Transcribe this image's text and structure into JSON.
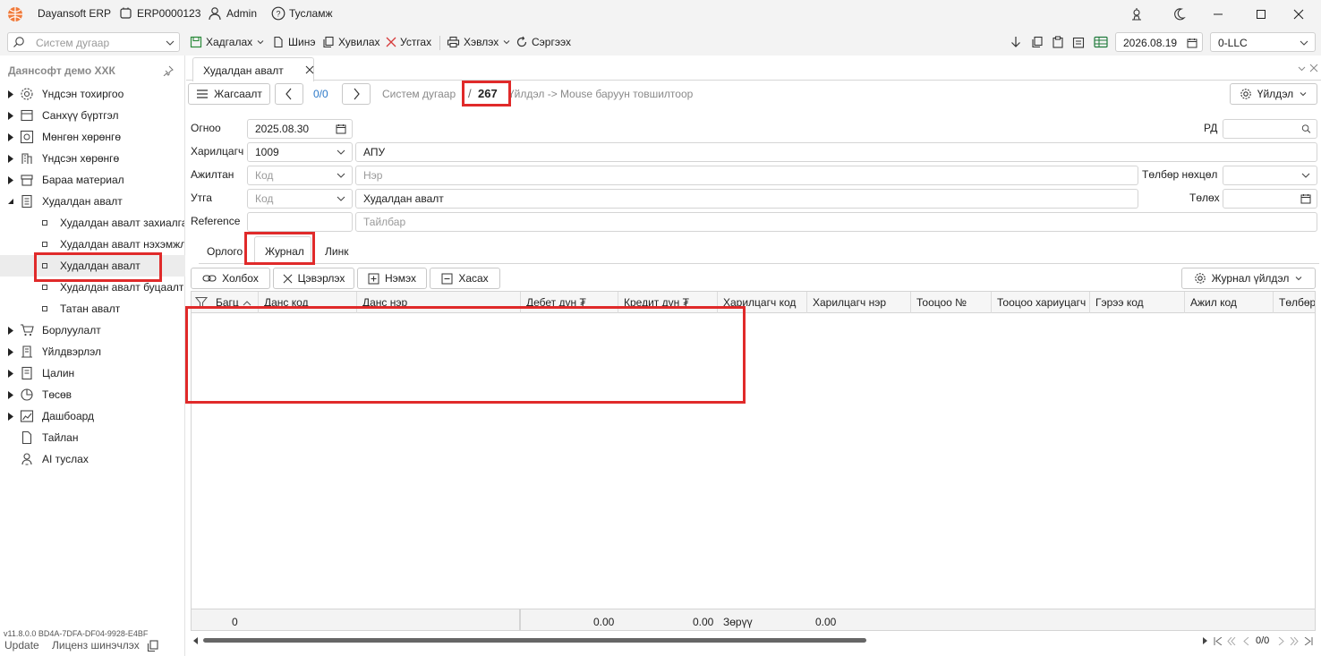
{
  "titlebar": {
    "app_name": "Dayansoft ERP",
    "erp_code": "ERP0000123",
    "user": "Admin",
    "help": "Тусламж"
  },
  "toolbar": {
    "search_placeholder": "Систем дугаар",
    "save": "Хадгалах",
    "new": "Шинэ",
    "copy": "Хувилах",
    "delete": "Устгах",
    "print": "Хэвлэх",
    "refresh": "Сэргээх",
    "date": "2026.08.19",
    "company": "0-LLC"
  },
  "sidebar": {
    "company": "Даянсофт демо ХХК",
    "items": [
      {
        "label": "Үндсэн тохиргоо",
        "icon": "gear-icon",
        "expand": "▸"
      },
      {
        "label": "Санхүү бүртгэл",
        "icon": "ledger-icon",
        "expand": "▸"
      },
      {
        "label": "Мөнгөн хөрөнгө",
        "icon": "money-icon",
        "expand": "▸"
      },
      {
        "label": "Үндсэн хөрөнгө",
        "icon": "building-icon",
        "expand": "▸"
      },
      {
        "label": "Бараа материал",
        "icon": "inventory-icon",
        "expand": "▸"
      },
      {
        "label": "Худалдан авалт",
        "icon": "purchase-icon",
        "expand": "▾"
      },
      {
        "label": "Худалдан авалт захиалга",
        "icon": "leaf-icon",
        "expand": ""
      },
      {
        "label": "Худалдан авалт нэхэмжлэх",
        "icon": "leaf-icon",
        "expand": ""
      },
      {
        "label": "Худалдан авалт",
        "icon": "leaf-icon",
        "expand": ""
      },
      {
        "label": "Худалдан авалт буцаалт",
        "icon": "leaf-icon",
        "expand": ""
      },
      {
        "label": "Татан авалт",
        "icon": "leaf-icon",
        "expand": ""
      },
      {
        "label": "Борлуулалт",
        "icon": "cart-icon",
        "expand": "▸"
      },
      {
        "label": "Үйлдвэрлэл",
        "icon": "factory-icon",
        "expand": "▸"
      },
      {
        "label": "Цалин",
        "icon": "salary-icon",
        "expand": "▸"
      },
      {
        "label": "Төсөв",
        "icon": "budget-icon",
        "expand": "▸"
      },
      {
        "label": "Дашбоард",
        "icon": "dashboard-icon",
        "expand": "▸"
      },
      {
        "label": "Тайлан",
        "icon": "report-icon",
        "expand": ""
      },
      {
        "label": "AI туслах",
        "icon": "ai-icon",
        "expand": ""
      }
    ],
    "version": "v11.8.0.0  BD4A-7DFA-DF04-9928-E4BF",
    "update": "Update",
    "license": "Лиценз шинэчлэх"
  },
  "tab": {
    "title": "Худалдан авалт"
  },
  "doc": {
    "list_btn": "Жагсаалт",
    "nav_count": "0/0",
    "sys_no_label": "Систем дугаар",
    "slash": "/",
    "sys_no": "267",
    "hint": "Үйлдэл -> Mouse баруун товшилтоор",
    "action_btn": "Үйлдэл"
  },
  "form": {
    "date_label": "Огноо",
    "date": "2025.08.30",
    "partner_label": "Харилцагч",
    "partner_code": "1009",
    "partner_name": "АПУ",
    "employee_label": "Ажилтан",
    "employee_code_ph": "Код",
    "employee_name_ph": "Нэр",
    "warehouse_label": "Утга",
    "warehouse_code_ph": "Код",
    "warehouse_desc": "Худалдан авалт",
    "reference_label": "Reference",
    "note_ph": "Тайлбар",
    "rd_label": "РД",
    "payment_label": "Төлбөр нөхцөл",
    "pay_label": "Төлөх"
  },
  "subtabs": [
    "Орлого",
    "Журнал",
    "Линк"
  ],
  "journal": {
    "link_btn": "Холбох",
    "clear_btn": "Цэвэрлэх",
    "add_btn": "Нэмэх",
    "remove_btn": "Хасах",
    "action_btn": "Журнал үйлдэл",
    "columns": [
      "Багц",
      "Данс код",
      "Данс нэр",
      "Дебет дүн ₮",
      "Кредит дүн ₮",
      "Харилцагч код",
      "Харилцагч нэр",
      "Тооцоо №",
      "Тооцоо хариуцагч",
      "Гэрээ код",
      "Ажил код",
      "Төлбөр"
    ],
    "footer": {
      "count": "0",
      "debit": "0.00",
      "credit": "0.00",
      "diff_label": "Зөрүү",
      "diff": "0.00"
    },
    "pager": "0/0"
  }
}
